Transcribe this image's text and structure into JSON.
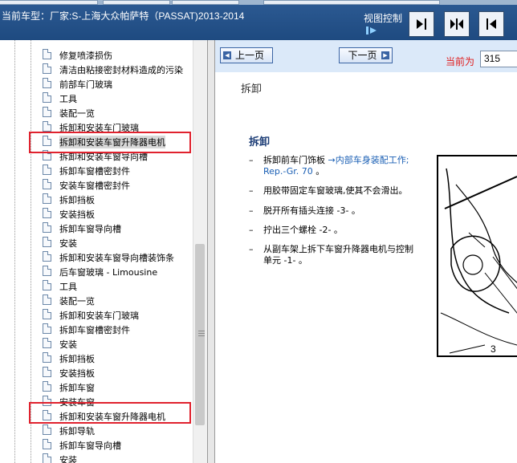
{
  "header": {
    "car_model_label": "当前车型：厂家:S-上海大众帕萨特（PASSAT)2013-2014",
    "view_control_label": "视图控制",
    "view_buttons": [
      "collapse-left-icon",
      "split-view-icon",
      "collapse-right-icon"
    ]
  },
  "sidebar": {
    "items": [
      {
        "label": "修复喷漆损伤"
      },
      {
        "label": "清洁由粘接密封材料造成的污染"
      },
      {
        "label": "前部车门玻璃"
      },
      {
        "label": "工具"
      },
      {
        "label": "装配一览"
      },
      {
        "label": "拆卸和安装车门玻璃"
      },
      {
        "label": "拆卸和安装车窗升降器电机"
      },
      {
        "label": "拆卸和安装车窗导向槽"
      },
      {
        "label": "拆卸车窗槽密封件"
      },
      {
        "label": "安装车窗槽密封件"
      },
      {
        "label": "拆卸挡板"
      },
      {
        "label": "安装挡板"
      },
      {
        "label": "拆卸车窗导向槽"
      },
      {
        "label": "安装"
      },
      {
        "label": "拆卸和安装车窗导向槽装饰条"
      },
      {
        "label": "后车窗玻璃 - Limousine"
      },
      {
        "label": "工具"
      },
      {
        "label": "装配一览"
      },
      {
        "label": "拆卸和安装车门玻璃"
      },
      {
        "label": "拆卸车窗槽密封件"
      },
      {
        "label": "安装"
      },
      {
        "label": "拆卸挡板"
      },
      {
        "label": "安装挡板"
      },
      {
        "label": "拆卸车窗"
      },
      {
        "label": "安装车窗"
      },
      {
        "label": "拆卸和安装车窗升降器电机"
      },
      {
        "label": "拆卸导轨"
      },
      {
        "label": "拆卸车窗导向槽"
      },
      {
        "label": "安装"
      }
    ]
  },
  "nav": {
    "prev_label": "上一页",
    "next_label": "下一页",
    "current_page_label": "当前为",
    "current_page_value": "315"
  },
  "content": {
    "section_title": "拆卸",
    "sub_title": "拆卸",
    "steps": [
      {
        "dash": "–",
        "text": "拆卸前车门饰板",
        "link": "→内部车身装配工作; Rep.-Gr. 70",
        "suffix": "。"
      },
      {
        "dash": "–",
        "text": "用胶带固定车窗玻璃,使其不会滑出。"
      },
      {
        "dash": "–",
        "text": "脱开所有插头连接 -3- 。"
      },
      {
        "dash": "–",
        "text": "拧出三个螺栓 -2- 。"
      },
      {
        "dash": "–",
        "text": "从副车架上拆下车窗升降器电机与控制单元 -1- 。"
      }
    ],
    "figure_callout": "3"
  },
  "colors": {
    "header_bg": "#1e4a80",
    "highlight_red": "#e0222e",
    "page_label_red": "#e01a1a",
    "navbar_bg": "#dbe9f9"
  }
}
